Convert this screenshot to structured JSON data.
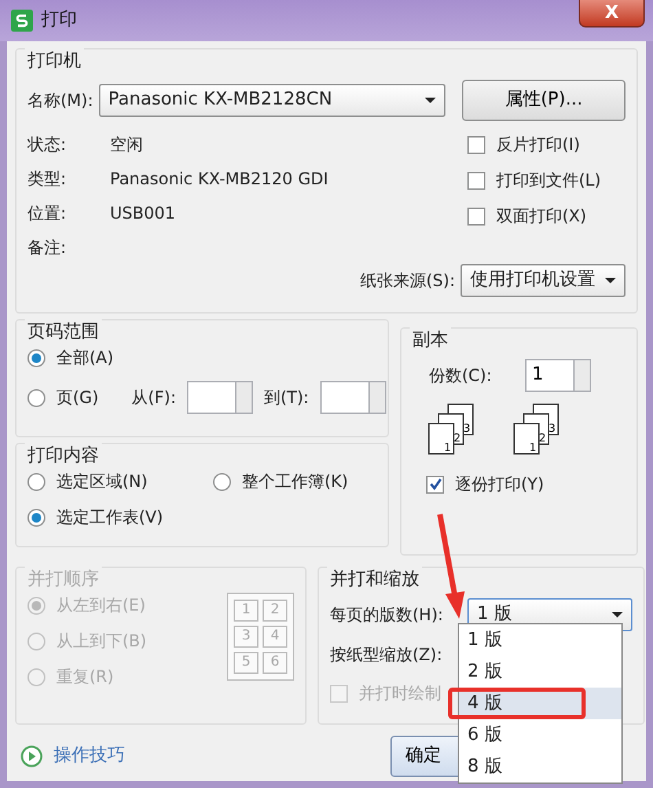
{
  "window": {
    "title": "打印",
    "close": "X"
  },
  "printer": {
    "title": "打印机",
    "name_label": "名称(M):",
    "name_value": "Panasonic KX-MB2128CN",
    "properties_button": "属性(P)...",
    "info": [
      {
        "label": "状态:",
        "value": "空闲"
      },
      {
        "label": "类型:",
        "value": "Panasonic KX-MB2120 GDI"
      },
      {
        "label": "位置:",
        "value": "USB001"
      },
      {
        "label": "备注:"
      }
    ],
    "checkboxes": [
      {
        "label": "反片打印(I)",
        "checked": false
      },
      {
        "label": "打印到文件(L)",
        "checked": false
      },
      {
        "label": "双面打印(X)",
        "checked": false
      }
    ],
    "paper_source_label": "纸张来源(S):",
    "paper_source_value": "使用打印机设置"
  },
  "page_range": {
    "title": "页码范围",
    "options": [
      {
        "label": "全部(A)",
        "selected": true
      },
      {
        "label": "页(G)",
        "selected": false
      }
    ],
    "from_label": "从(F):",
    "to_label": "到(T):"
  },
  "print_content": {
    "title": "打印内容",
    "options": [
      {
        "label": "选定区域(N)",
        "selected": false
      },
      {
        "label": "整个工作簿(K)",
        "selected": false
      },
      {
        "label": "选定工作表(V)",
        "selected": true
      }
    ]
  },
  "copies": {
    "title": "副本",
    "count_label": "份数(C):",
    "count_value": "1",
    "collate": {
      "label": "逐份打印(Y)",
      "checked": true
    },
    "icons": [
      {
        "numbers": [
          "1",
          "2",
          "3"
        ]
      },
      {
        "numbers": [
          "1",
          "2",
          "3"
        ]
      }
    ]
  },
  "merge_order": {
    "title": "并打顺序",
    "disabled": true,
    "options": [
      {
        "label": "从左到右(E)",
        "selected": true
      },
      {
        "label": "从上到下(B)",
        "selected": false
      },
      {
        "label": "重复(R)",
        "selected": false
      }
    ],
    "grid": [
      "1",
      "2",
      "3",
      "4",
      "5",
      "6"
    ]
  },
  "merge_scale": {
    "title": "并打和缩放",
    "pages_label": "每页的版数(H):",
    "pages_value": "1 版",
    "scale_label": "按纸型缩放(Z):",
    "draw_border": {
      "label": "并打时绘制",
      "checked": false,
      "disabled": true
    },
    "dropdown": [
      {
        "label": "1 版",
        "selected": false
      },
      {
        "label": "2 版",
        "selected": false
      },
      {
        "label": "4 版",
        "selected": true
      },
      {
        "label": "6 版",
        "selected": false
      },
      {
        "label": "8 版",
        "selected": false
      }
    ]
  },
  "footer": {
    "tips_link": "操作技巧",
    "ok_button": "确定"
  }
}
